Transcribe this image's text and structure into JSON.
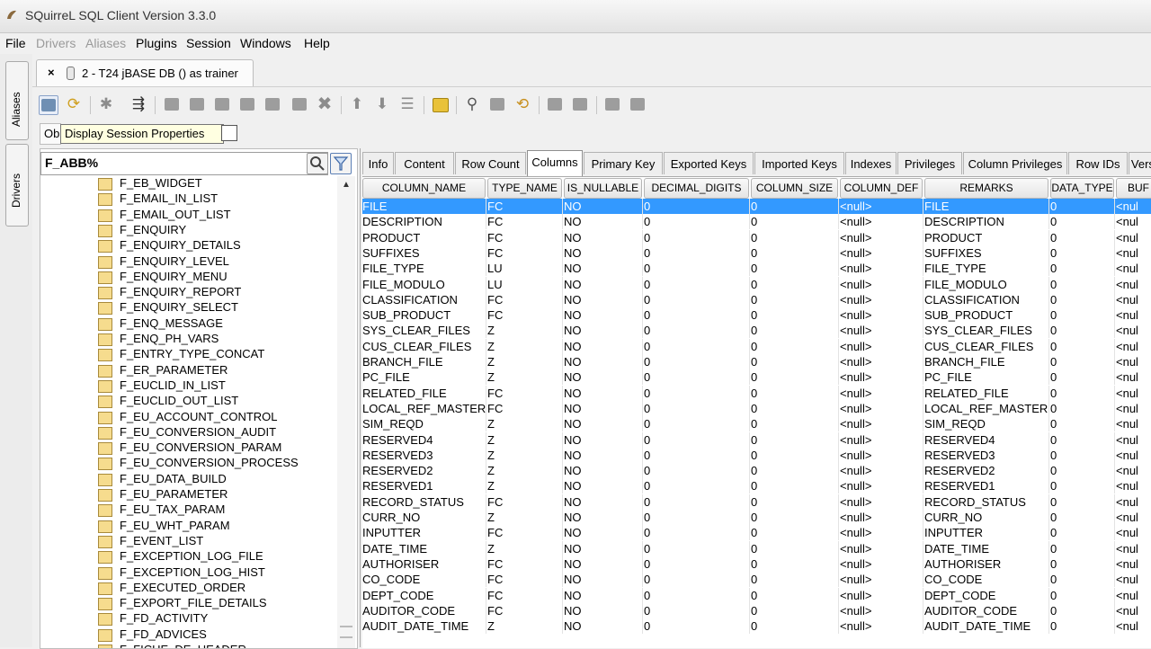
{
  "window": {
    "title": "SQuirreL SQL Client Version 3.3.0"
  },
  "menu": {
    "items": [
      "File",
      "Drivers",
      "Aliases",
      "Plugins",
      "Session",
      "Windows",
      "Help"
    ]
  },
  "left_tabs": {
    "aliases": "Aliases",
    "drivers": "Drivers"
  },
  "session_tab": {
    "label": "2 - T24 jBASE DB () as trainer",
    "close": "×"
  },
  "tooltip": "Display Session Properties",
  "objects_tab": {
    "label": "Ob"
  },
  "filter": {
    "value": "F_ABB%"
  },
  "tree": {
    "items": [
      "F_EB_WIDGET",
      "F_EMAIL_IN_LIST",
      "F_EMAIL_OUT_LIST",
      "F_ENQUIRY",
      "F_ENQUIRY_DETAILS",
      "F_ENQUIRY_LEVEL",
      "F_ENQUIRY_MENU",
      "F_ENQUIRY_REPORT",
      "F_ENQUIRY_SELECT",
      "F_ENQ_MESSAGE",
      "F_ENQ_PH_VARS",
      "F_ENTRY_TYPE_CONCAT",
      "F_ER_PARAMETER",
      "F_EUCLID_IN_LIST",
      "F_EUCLID_OUT_LIST",
      "F_EU_ACCOUNT_CONTROL",
      "F_EU_CONVERSION_AUDIT",
      "F_EU_CONVERSION_PARAM",
      "F_EU_CONVERSION_PROCESS",
      "F_EU_DATA_BUILD",
      "F_EU_PARAMETER",
      "F_EU_TAX_PARAM",
      "F_EU_WHT_PARAM",
      "F_EVENT_LIST",
      "F_EXCEPTION_LOG_FILE",
      "F_EXCEPTION_LOG_HIST",
      "F_EXECUTED_ORDER",
      "F_EXPORT_FILE_DETAILS",
      "F_FD_ACTIVITY",
      "F_FD_ADVICES",
      "F_FICHE_DE_HEADER"
    ]
  },
  "tabs": [
    "Info",
    "Content",
    "Row Count",
    "Columns",
    "Primary Key",
    "Exported Keys",
    "Imported Keys",
    "Indexes",
    "Privileges",
    "Column Privileges",
    "Row IDs",
    "Versio"
  ],
  "active_tab": "Columns",
  "table": {
    "headers": [
      "COLUMN_NAME",
      "TYPE_NAME",
      "IS_NULLABLE",
      "DECIMAL_DIGITS",
      "COLUMN_SIZE",
      "COLUMN_DEF",
      "REMARKS",
      "DATA_TYPE",
      "BUF"
    ],
    "rows": [
      [
        "FILE",
        "FC",
        "NO",
        "0",
        "0",
        "<null>",
        "FILE",
        "0",
        "<nul"
      ],
      [
        "DESCRIPTION",
        "FC",
        "NO",
        "0",
        "0",
        "<null>",
        "DESCRIPTION",
        "0",
        "<nul"
      ],
      [
        "PRODUCT",
        "FC",
        "NO",
        "0",
        "0",
        "<null>",
        "PRODUCT",
        "0",
        "<nul"
      ],
      [
        "SUFFIXES",
        "FC",
        "NO",
        "0",
        "0",
        "<null>",
        "SUFFIXES",
        "0",
        "<nul"
      ],
      [
        "FILE_TYPE",
        "LU",
        "NO",
        "0",
        "0",
        "<null>",
        "FILE_TYPE",
        "0",
        "<nul"
      ],
      [
        "FILE_MODULO",
        "LU",
        "NO",
        "0",
        "0",
        "<null>",
        "FILE_MODULO",
        "0",
        "<nul"
      ],
      [
        "CLASSIFICATION",
        "FC",
        "NO",
        "0",
        "0",
        "<null>",
        "CLASSIFICATION",
        "0",
        "<nul"
      ],
      [
        "SUB_PRODUCT",
        "FC",
        "NO",
        "0",
        "0",
        "<null>",
        "SUB_PRODUCT",
        "0",
        "<nul"
      ],
      [
        "SYS_CLEAR_FILES",
        "Z",
        "NO",
        "0",
        "0",
        "<null>",
        "SYS_CLEAR_FILES",
        "0",
        "<nul"
      ],
      [
        "CUS_CLEAR_FILES",
        "Z",
        "NO",
        "0",
        "0",
        "<null>",
        "CUS_CLEAR_FILES",
        "0",
        "<nul"
      ],
      [
        "BRANCH_FILE",
        "Z",
        "NO",
        "0",
        "0",
        "<null>",
        "BRANCH_FILE",
        "0",
        "<nul"
      ],
      [
        "PC_FILE",
        "Z",
        "NO",
        "0",
        "0",
        "<null>",
        "PC_FILE",
        "0",
        "<nul"
      ],
      [
        "RELATED_FILE",
        "FC",
        "NO",
        "0",
        "0",
        "<null>",
        "RELATED_FILE",
        "0",
        "<nul"
      ],
      [
        "LOCAL_REF_MASTER",
        "FC",
        "NO",
        "0",
        "0",
        "<null>",
        "LOCAL_REF_MASTER",
        "0",
        "<nul"
      ],
      [
        "SIM_REQD",
        "Z",
        "NO",
        "0",
        "0",
        "<null>",
        "SIM_REQD",
        "0",
        "<nul"
      ],
      [
        "RESERVED4",
        "Z",
        "NO",
        "0",
        "0",
        "<null>",
        "RESERVED4",
        "0",
        "<nul"
      ],
      [
        "RESERVED3",
        "Z",
        "NO",
        "0",
        "0",
        "<null>",
        "RESERVED3",
        "0",
        "<nul"
      ],
      [
        "RESERVED2",
        "Z",
        "NO",
        "0",
        "0",
        "<null>",
        "RESERVED2",
        "0",
        "<nul"
      ],
      [
        "RESERVED1",
        "Z",
        "NO",
        "0",
        "0",
        "<null>",
        "RESERVED1",
        "0",
        "<nul"
      ],
      [
        "RECORD_STATUS",
        "FC",
        "NO",
        "0",
        "0",
        "<null>",
        "RECORD_STATUS",
        "0",
        "<nul"
      ],
      [
        "CURR_NO",
        "Z",
        "NO",
        "0",
        "0",
        "<null>",
        "CURR_NO",
        "0",
        "<nul"
      ],
      [
        "INPUTTER",
        "FC",
        "NO",
        "0",
        "0",
        "<null>",
        "INPUTTER",
        "0",
        "<nul"
      ],
      [
        "DATE_TIME",
        "Z",
        "NO",
        "0",
        "0",
        "<null>",
        "DATE_TIME",
        "0",
        "<nul"
      ],
      [
        "AUTHORISER",
        "FC",
        "NO",
        "0",
        "0",
        "<null>",
        "AUTHORISER",
        "0",
        "<nul"
      ],
      [
        "CO_CODE",
        "FC",
        "NO",
        "0",
        "0",
        "<null>",
        "CO_CODE",
        "0",
        "<nul"
      ],
      [
        "DEPT_CODE",
        "FC",
        "NO",
        "0",
        "0",
        "<null>",
        "DEPT_CODE",
        "0",
        "<nul"
      ],
      [
        "AUDITOR_CODE",
        "FC",
        "NO",
        "0",
        "0",
        "<null>",
        "AUDITOR_CODE",
        "0",
        "<nul"
      ],
      [
        "AUDIT_DATE_TIME",
        "Z",
        "NO",
        "0",
        "0",
        "<null>",
        "AUDIT_DATE_TIME",
        "0",
        "<nul"
      ]
    ],
    "selected_row": 0
  },
  "colors": {
    "selection": "#3399ff",
    "tooltip_bg": "#ffffe1"
  }
}
